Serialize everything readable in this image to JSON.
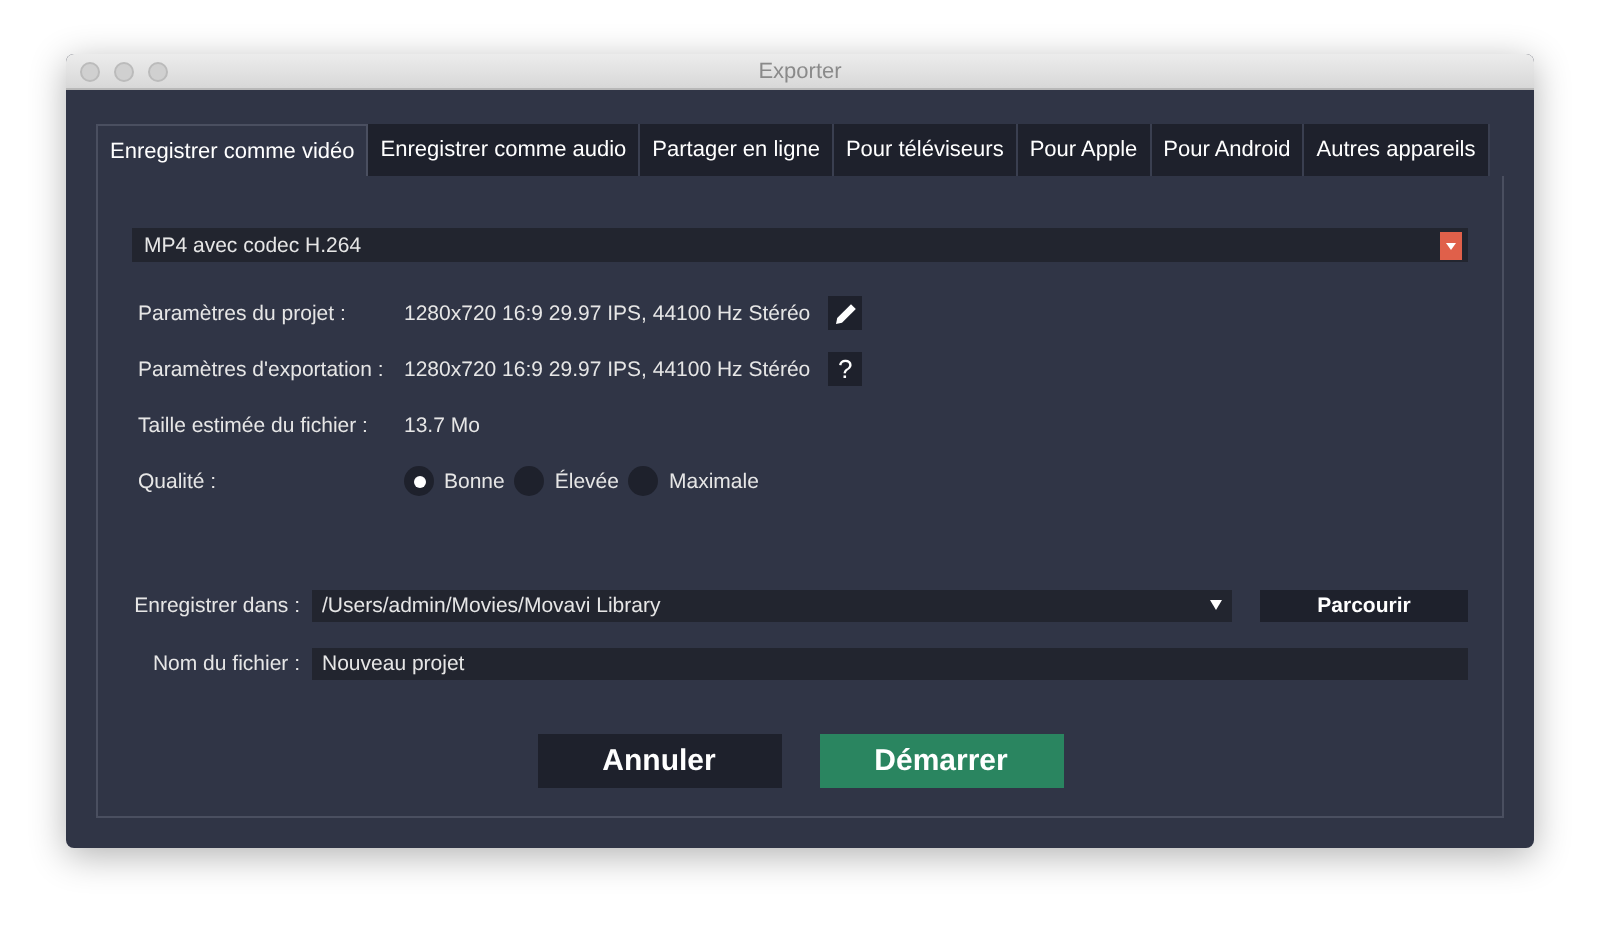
{
  "window": {
    "title": "Exporter"
  },
  "tabs": [
    {
      "label": "Enregistrer comme vidéo",
      "selected": true
    },
    {
      "label": "Enregistrer comme audio",
      "selected": false
    },
    {
      "label": "Partager en ligne",
      "selected": false
    },
    {
      "label": "Pour téléviseurs",
      "selected": false
    },
    {
      "label": "Pour Apple",
      "selected": false
    },
    {
      "label": "Pour Android",
      "selected": false
    },
    {
      "label": "Autres appareils",
      "selected": false
    }
  ],
  "format": {
    "value": "MP4 avec codec H.264"
  },
  "settings": [
    {
      "label": "Paramètres du projet :",
      "value": "1280x720 16:9 29.97 IPS, 44100 Hz Stéréo",
      "kind": "edit"
    },
    {
      "label": "Paramètres d'exportation :",
      "value": "1280x720 16:9 29.97 IPS, 44100 Hz Stéréo",
      "kind": "help",
      "icon_text": "?"
    },
    {
      "label": "Taille estimée du fichier :",
      "value": "13.7 Mo",
      "kind": "plain"
    }
  ],
  "quality": {
    "label": "Qualité :",
    "options": [
      {
        "label": "Bonne",
        "selected": true
      },
      {
        "label": "Élevée",
        "selected": false
      },
      {
        "label": "Maximale",
        "selected": false
      }
    ]
  },
  "save_in": {
    "label": "Enregistrer dans :",
    "value": "/Users/admin/Movies/Movavi Library",
    "browse": "Parcourir"
  },
  "file_name": {
    "label": "Nom du fichier :",
    "value": "Nouveau projet"
  },
  "buttons": [
    {
      "label": "Annuler",
      "kind": "cancel"
    },
    {
      "label": "Démarrer",
      "kind": "primary"
    }
  ]
}
